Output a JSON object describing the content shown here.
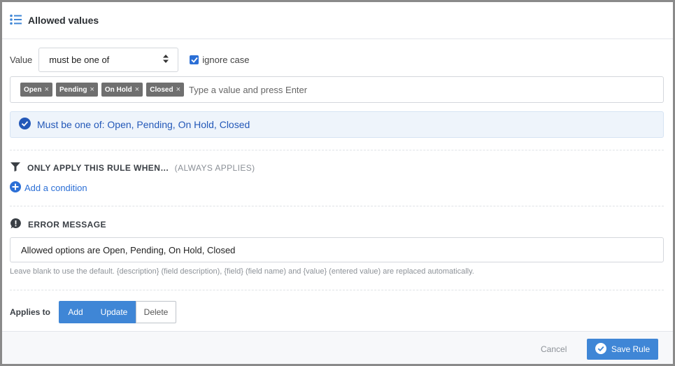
{
  "header": {
    "title": "Allowed values",
    "icon": "list-icon"
  },
  "value_row": {
    "label": "Value",
    "operator": "must be one of",
    "ignore_case_label": "ignore case",
    "ignore_case_checked": true
  },
  "tags": {
    "items": [
      "Open",
      "Pending",
      "On Hold",
      "Closed"
    ],
    "remove_glyph": "×",
    "placeholder": "Type a value and press Enter"
  },
  "summary": {
    "text": "Must be one of: Open, Pending, On Hold, Closed"
  },
  "condition": {
    "heading": "ONLY APPLY THIS RULE WHEN…",
    "subheading": "(ALWAYS APPLIES)",
    "add_label": "Add a condition"
  },
  "error": {
    "heading": "ERROR MESSAGE",
    "value": "Allowed options are Open, Pending, On Hold, Closed",
    "help": "Leave blank to use the default. {description} (field description), {field} (field name) and {value} (entered value) are replaced automatically."
  },
  "applies": {
    "label": "Applies to",
    "options": [
      {
        "label": "Add",
        "active": true
      },
      {
        "label": "Update",
        "active": true
      },
      {
        "label": "Delete",
        "active": false
      }
    ]
  },
  "footer": {
    "cancel": "Cancel",
    "save": "Save Rule"
  },
  "colors": {
    "accent": "#3f86d6",
    "link": "#2b6fd6",
    "tag": "#6f6f6f",
    "info_bg": "#eef4fb"
  }
}
